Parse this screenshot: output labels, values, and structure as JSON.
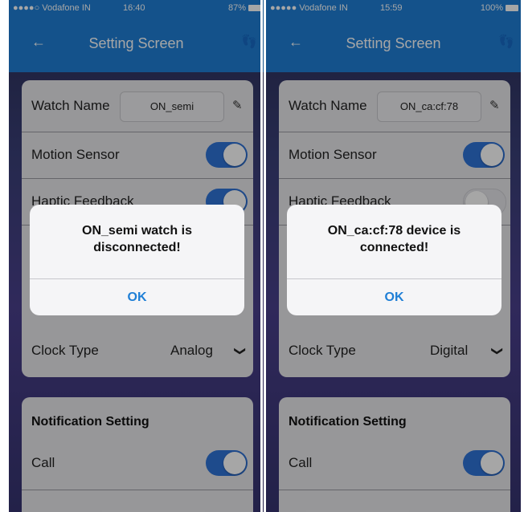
{
  "screens": [
    {
      "status": {
        "carrier": "●●●●○ Vodafone IN",
        "time": "16:40",
        "battery": "87%"
      },
      "nav": {
        "back": "←",
        "title": "Setting Screen",
        "feet_icon": "footsteps-icon"
      },
      "watch_name": {
        "label": "Watch Name",
        "value": "ON_semi"
      },
      "motion_sensor": {
        "label": "Motion Sensor",
        "on": true
      },
      "haptic_feedback": {
        "label": "Haptic Feedback",
        "on": true
      },
      "clock_type": {
        "label": "Clock Type",
        "value": "Analog"
      },
      "notification": {
        "title": "Notification Setting",
        "call_label": "Call",
        "call_on": true
      },
      "dialog": {
        "message": "ON_semi watch is disconnected!",
        "button": "OK"
      }
    },
    {
      "status": {
        "carrier": "●●●●● Vodafone IN",
        "time": "15:59",
        "battery": "100%"
      },
      "nav": {
        "back": "←",
        "title": "Setting Screen",
        "feet_icon": "footsteps-icon"
      },
      "watch_name": {
        "label": "Watch Name",
        "value": "ON_ca:cf:78"
      },
      "motion_sensor": {
        "label": "Motion Sensor",
        "on": true
      },
      "haptic_feedback": {
        "label": "Haptic Feedback",
        "on": false
      },
      "clock_type": {
        "label": "Clock Type",
        "value": "Digital"
      },
      "notification": {
        "title": "Notification Setting",
        "call_label": "Call",
        "call_on": true
      },
      "dialog": {
        "message": "ON_ca:cf:78 device is connected!",
        "button": "OK"
      }
    }
  ],
  "colors": {
    "accent": "#1f7fd6",
    "toggle_on": "#2f73d8"
  }
}
